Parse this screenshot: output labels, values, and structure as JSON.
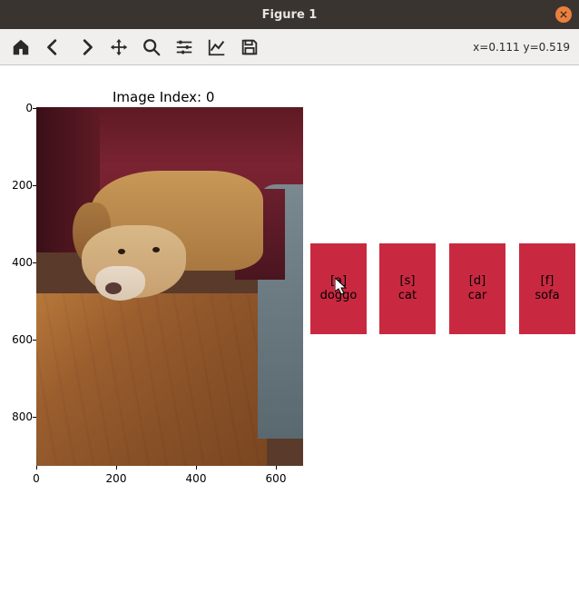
{
  "window": {
    "title": "Figure 1"
  },
  "toolbar": {
    "coords": "x=0.111 y=0.519"
  },
  "plot": {
    "title": "Image Index: 0",
    "y_ticks": [
      "0",
      "200",
      "400",
      "600",
      "800"
    ],
    "x_ticks": [
      "0",
      "200",
      "400",
      "600"
    ]
  },
  "buttons": [
    {
      "key": "[a]",
      "label": "doggo"
    },
    {
      "key": "[s]",
      "label": "cat"
    },
    {
      "key": "[d]",
      "label": "car"
    },
    {
      "key": "[f]",
      "label": "sofa"
    }
  ]
}
